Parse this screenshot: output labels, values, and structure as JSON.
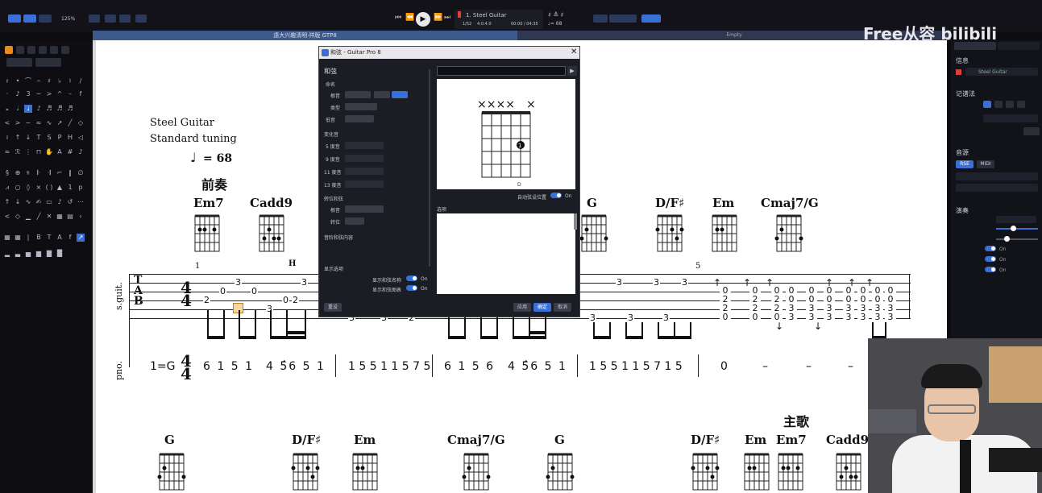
{
  "toolbar": {
    "zoom": "125%",
    "track_title": "1. Steel Guitar",
    "bar_position": "1/52",
    "time_sig": "4.0:4.0",
    "time_counter": "00:00 / 04:35",
    "tempo_display": "♩= 68"
  },
  "tabs": [
    {
      "label": "遠大兴趣清明·祥版 GTP8"
    },
    {
      "label": "Empty"
    }
  ],
  "score": {
    "track_name": "Steel Guitar",
    "tuning": "Standard tuning",
    "tempo_mark": "= 68",
    "section_intro": "前奏",
    "section_verse": "主歌",
    "staff_label_guitar": "s.guit.",
    "staff_label_jianpu": "pno.",
    "key_label": "1=G",
    "bar_number_1": "1",
    "bar_number_5": "5",
    "hammer_label": "H",
    "chords_row1": [
      "Em7",
      "Cadd9",
      "G",
      "D/F♯",
      "Em",
      "Cmaj7/G"
    ],
    "chords_row2": [
      "G",
      "D/F♯",
      "Em",
      "Cmaj7/G",
      "G",
      "D/F♯",
      "Em",
      "Em7",
      "Cadd9"
    ],
    "jianpu_groups": [
      "6 1 5 1",
      "4 5̂6 5 1",
      "1 5 5 1 1 5 7 5",
      "6 1 5 6",
      "4 5̂6 5 1",
      "1 5 5 1 1 5 7 1 5",
      "0",
      "–",
      "–",
      "–"
    ]
  },
  "dialog": {
    "title": "和弦 - Guitar Pro 8",
    "section_chord": "和弦",
    "label_name": "命名",
    "label_root": "根音",
    "label_type": "类型",
    "label_bass": "低音",
    "label_alter": "变化音",
    "label_5th": "5 度音",
    "label_9th": "9 度音",
    "label_11th": "11 度音",
    "label_13th": "13 度音",
    "label_transpose": "转位和弦",
    "label_root2": "根音",
    "label_inversion": "转位",
    "label_contains": "音阶和弦内容",
    "label_display": "显示选项",
    "show_chord_name": "显示和弦名称",
    "show_diagram": "显示和弦图表",
    "on1": "On",
    "on2": "On",
    "on3": "On",
    "diagram_label": "D",
    "auto_fret_pos": "自动弦设位置",
    "voicing_label": "选项",
    "btn_reset": "重设",
    "btn_apply": "应用",
    "btn_ok": "确定",
    "btn_cancel": "取消"
  },
  "right_panel": {
    "section_track": "信息",
    "track_name": "Steel Guitar",
    "section_notation": "记谱法",
    "section_sound": "音源",
    "sound_tab1": "RSE",
    "sound_tab2": "MIDI",
    "section_mixer": "演奏",
    "on_a": "On",
    "on_b": "On",
    "on_c": "On"
  },
  "watermark": "Free从容 bilibili"
}
